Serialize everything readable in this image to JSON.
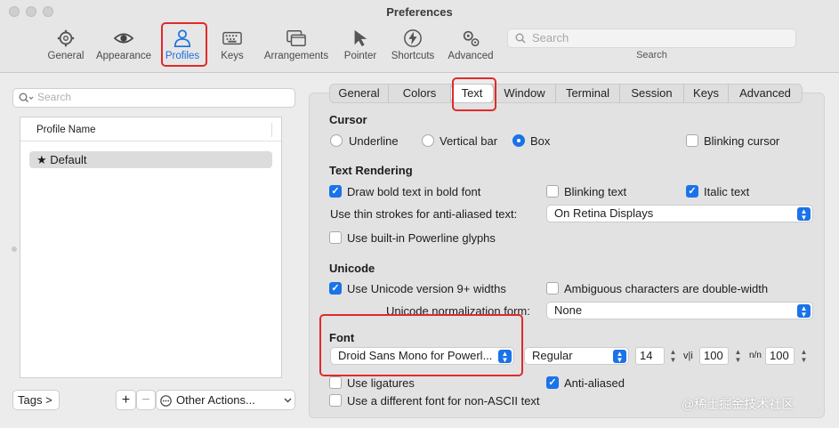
{
  "window": {
    "title": "Preferences"
  },
  "toolbar": {
    "items": [
      {
        "label": "General",
        "icon": "gear-icon"
      },
      {
        "label": "Appearance",
        "icon": "eye-icon"
      },
      {
        "label": "Profiles",
        "icon": "person-icon"
      },
      {
        "label": "Keys",
        "icon": "keyboard-icon"
      },
      {
        "label": "Arrangements",
        "icon": "windows-icon"
      },
      {
        "label": "Pointer",
        "icon": "pointer-icon"
      },
      {
        "label": "Shortcuts",
        "icon": "bolt-icon"
      },
      {
        "label": "Advanced",
        "icon": "gears-icon"
      }
    ],
    "active": "Profiles",
    "search_placeholder": "Search",
    "search_label": "Search"
  },
  "profiles": {
    "search_placeholder": "Search",
    "column_header": "Profile Name",
    "rows": [
      "★ Default"
    ],
    "tags_button": "Tags >",
    "add_button": "+",
    "remove_button": "−",
    "other_actions": "Other Actions..."
  },
  "tabs": [
    "General",
    "Colors",
    "Text",
    "Window",
    "Terminal",
    "Session",
    "Keys",
    "Advanced"
  ],
  "selected_tab": "Text",
  "cursor": {
    "heading": "Cursor",
    "options": [
      "Underline",
      "Vertical bar",
      "Box"
    ],
    "selected": "Box",
    "blinking_label": "Blinking cursor",
    "blinking": false
  },
  "text_rendering": {
    "heading": "Text Rendering",
    "bold_label": "Draw bold text in bold font",
    "bold": true,
    "blinking_text_label": "Blinking text",
    "blinking_text": false,
    "italic_label": "Italic text",
    "italic": true,
    "thin_strokes_label": "Use thin strokes for anti-aliased text:",
    "thin_strokes_value": "On Retina Displays",
    "powerline_label": "Use built-in Powerline glyphs",
    "powerline": false
  },
  "unicode": {
    "heading": "Unicode",
    "v9_label": "Use Unicode version 9+ widths",
    "v9": true,
    "ambiguous_label": "Ambiguous characters are double-width",
    "ambiguous": false,
    "normalization_label": "Unicode normalization form:",
    "normalization_value": "None"
  },
  "font": {
    "heading": "Font",
    "family": "Droid Sans Mono for Powerl...",
    "style": "Regular",
    "size": "14",
    "vertical_spacing_icon": "v|i",
    "vertical_spacing": "100",
    "horizontal_spacing_icon": "n/n",
    "horizontal_spacing": "100",
    "ligatures_label": "Use ligatures",
    "ligatures": false,
    "antialiased_label": "Anti-aliased",
    "antialiased": true,
    "non_ascii_label": "Use a different font for non-ASCII text",
    "non_ascii": false
  },
  "watermark": "@稀土掘金技术社区",
  "colors": {
    "accent": "#1a73e8",
    "annotation_red": "#e02a2a"
  }
}
